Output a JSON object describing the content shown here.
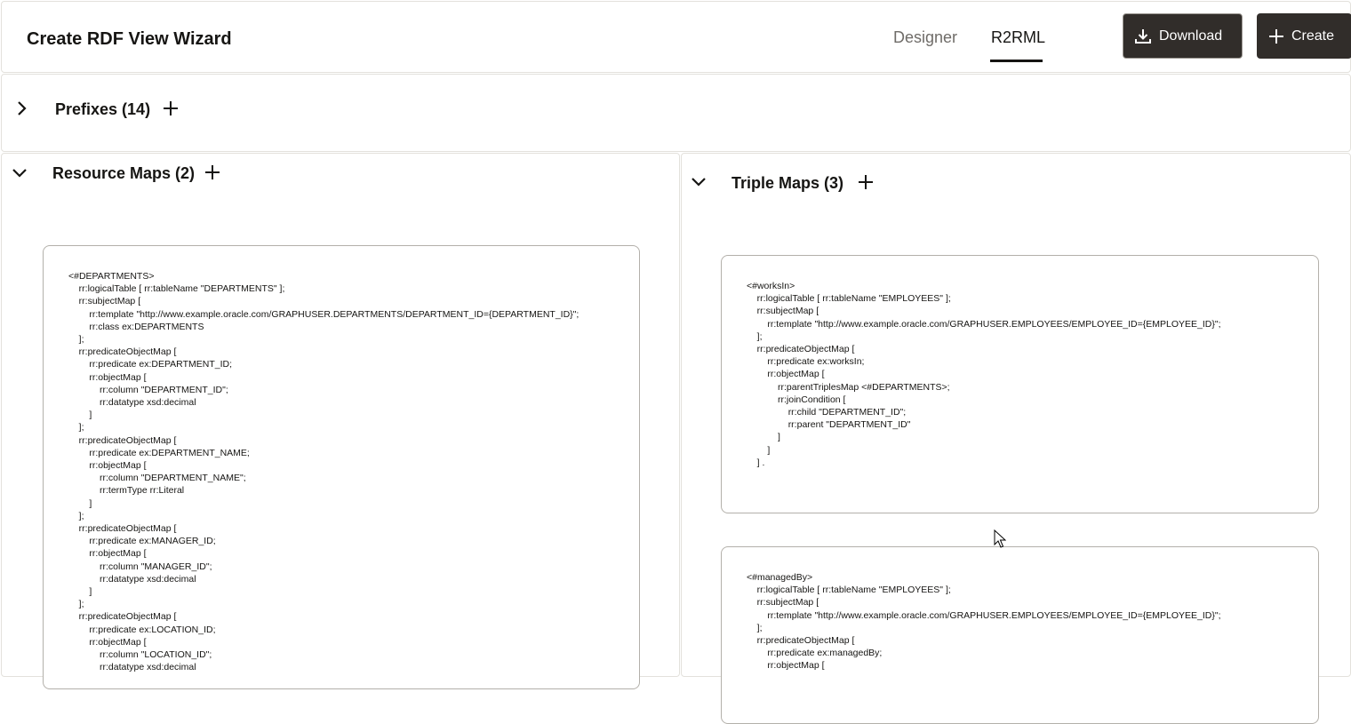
{
  "header": {
    "title": "Create RDF View Wizard",
    "tabs": [
      {
        "label": "Designer",
        "selected": false
      },
      {
        "label": "R2RML",
        "selected": true
      }
    ],
    "download_label": "Download",
    "create_label": "Create"
  },
  "prefixes": {
    "title": "Prefixes (14)",
    "expanded": false
  },
  "resource_maps": {
    "title": "Resource Maps (2)",
    "expanded": true,
    "cards": [
      {
        "code": "<#DEPARTMENTS>\n\trr:logicalTable [ rr:tableName \"DEPARTMENTS\" ];\n\trr:subjectMap [\n\t\trr:template \"http://www.example.oracle.com/GRAPHUSER.DEPARTMENTS/DEPARTMENT_ID={DEPARTMENT_ID}\";\n\t\trr:class ex:DEPARTMENTS\n\t];\n\trr:predicateObjectMap [\n\t\trr:predicate ex:DEPARTMENT_ID;\n\t\trr:objectMap [\n\t\t\trr:column \"DEPARTMENT_ID\";\n\t\t\trr:datatype xsd:decimal\n\t\t]\n\t];\n\trr:predicateObjectMap [\n\t\trr:predicate ex:DEPARTMENT_NAME;\n\t\trr:objectMap [\n\t\t\trr:column \"DEPARTMENT_NAME\";\n\t\t\trr:termType rr:Literal\n\t\t]\n\t];\n\trr:predicateObjectMap [\n\t\trr:predicate ex:MANAGER_ID;\n\t\trr:objectMap [\n\t\t\trr:column \"MANAGER_ID\";\n\t\t\trr:datatype xsd:decimal\n\t\t]\n\t];\n\trr:predicateObjectMap [\n\t\trr:predicate ex:LOCATION_ID;\n\t\trr:objectMap [\n\t\t\trr:column \"LOCATION_ID\";\n\t\t\trr:datatype xsd:decimal"
      }
    ]
  },
  "triple_maps": {
    "title": "Triple Maps (3)",
    "expanded": true,
    "cards": [
      {
        "code": "<#worksIn>\n\trr:logicalTable [ rr:tableName \"EMPLOYEES\" ];\n\trr:subjectMap [\n\t\trr:template \"http://www.example.oracle.com/GRAPHUSER.EMPLOYEES/EMPLOYEE_ID={EMPLOYEE_ID}\";\n\t];\n\trr:predicateObjectMap [\n\t\trr:predicate ex:worksIn;\n\t\trr:objectMap [\n\t\t\trr:parentTriplesMap <#DEPARTMENTS>;\n\t\t\trr:joinCondition [\n\t\t\t\trr:child \"DEPARTMENT_ID\";\n\t\t\t\trr:parent \"DEPARTMENT_ID\"\n\t\t\t]\n\t\t]\n\t] ."
      },
      {
        "code": "<#managedBy>\n\trr:logicalTable [ rr:tableName \"EMPLOYEES\" ];\n\trr:subjectMap [\n\t\trr:template \"http://www.example.oracle.com/GRAPHUSER.EMPLOYEES/EMPLOYEE_ID={EMPLOYEE_ID}\";\n\t];\n\trr:predicateObjectMap [\n\t\trr:predicate ex:managedBy;\n\t\trr:objectMap ["
      }
    ]
  },
  "colors": {
    "accent": "#312d2a",
    "border": "#e3e1dc",
    "muted_text": "#6f6c68"
  }
}
